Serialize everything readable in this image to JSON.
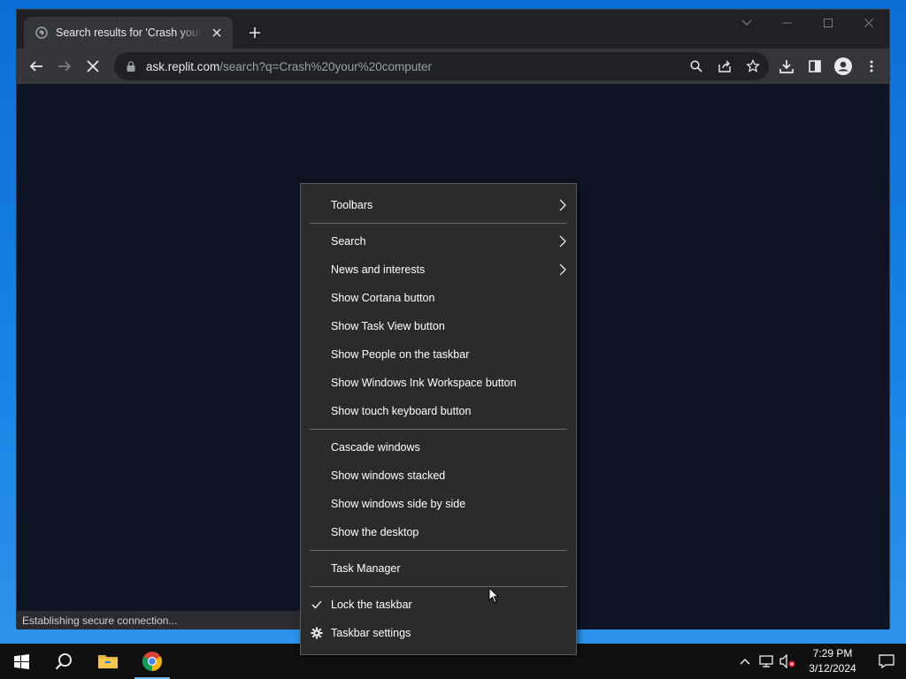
{
  "browser": {
    "tab": {
      "title": "Search results for 'Crash your computer'"
    },
    "omnibox": {
      "host": "ask.replit.com",
      "path": "/search?q=Crash%20your%20computer"
    },
    "status": "Establishing secure connection..."
  },
  "context_menu": {
    "items": [
      {
        "label": "Toolbars",
        "submenu": true
      },
      {
        "label": "Search",
        "submenu": true
      },
      {
        "label": "News and interests",
        "submenu": true
      },
      {
        "label": "Show Cortana button"
      },
      {
        "label": "Show Task View button"
      },
      {
        "label": "Show People on the taskbar"
      },
      {
        "label": "Show Windows Ink Workspace button"
      },
      {
        "label": "Show touch keyboard button"
      },
      {
        "label": "Cascade windows"
      },
      {
        "label": "Show windows stacked"
      },
      {
        "label": "Show windows side by side"
      },
      {
        "label": "Show the desktop"
      },
      {
        "label": "Task Manager"
      },
      {
        "label": "Lock the taskbar",
        "checked": true
      },
      {
        "label": "Taskbar settings",
        "icon": "gear-icon"
      }
    ]
  },
  "taskbar": {
    "icons": [
      "windows-start-icon",
      "search-icon",
      "file-explorer-icon",
      "chrome-icon"
    ],
    "clock": {
      "time": "7:29 PM",
      "date": "3/12/2024"
    }
  },
  "colors": {
    "desktop": "#1a86e6",
    "menu_bg": "#2b2b2b",
    "browser_bg": "#0f1424",
    "taskbar_bg": "#101010"
  }
}
